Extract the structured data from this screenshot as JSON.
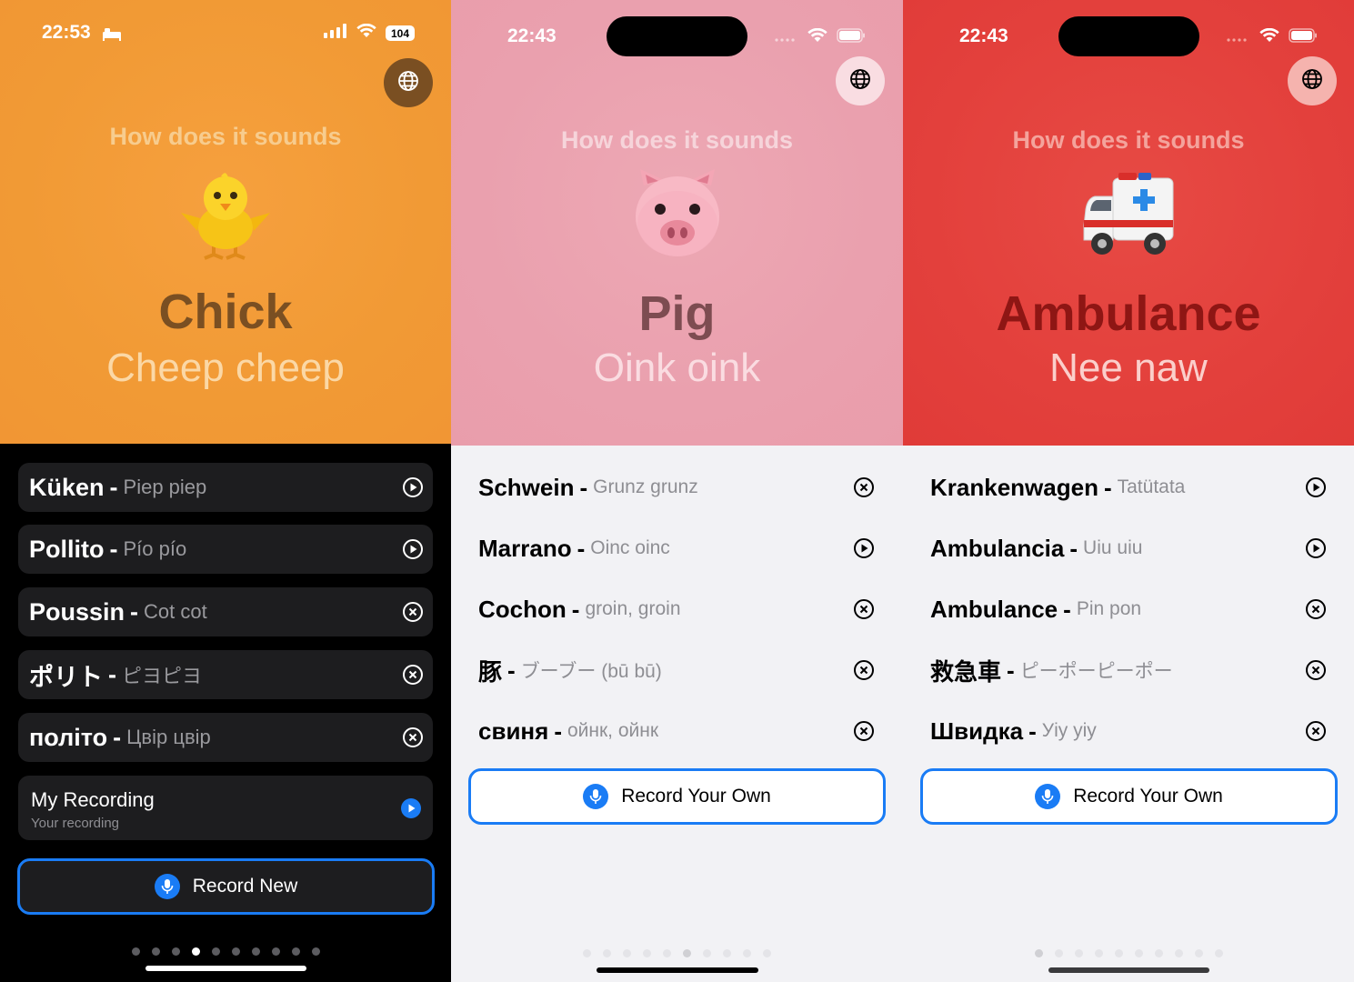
{
  "screens": [
    {
      "status": {
        "time": "22:53",
        "battery": "104"
      },
      "subtitle": "How does it sounds",
      "emoji_icon": "chick-emoji",
      "title": "Chick",
      "sound": "Cheep cheep",
      "items": [
        {
          "word": "Küken",
          "translation": "Piep piep",
          "icon": "play"
        },
        {
          "word": "Pollito",
          "translation": "Pío pío",
          "icon": "play"
        },
        {
          "word": "Poussin",
          "translation": "Cot cot",
          "icon": "close"
        },
        {
          "word": "ポリト",
          "translation": "ピヨピヨ",
          "icon": "close"
        },
        {
          "word": "політо",
          "translation": "Цвір цвір",
          "icon": "close"
        }
      ],
      "recording": {
        "title": "My Recording",
        "subtitle": "Your recording"
      },
      "record_button": "Record New",
      "page_count": 10,
      "active_page": 3
    },
    {
      "status": {
        "time": "22:43"
      },
      "subtitle": "How does it sounds",
      "emoji_icon": "pig-emoji",
      "title": "Pig",
      "sound": "Oink oink",
      "items": [
        {
          "word": "Schwein",
          "translation": "Grunz grunz",
          "icon": "close"
        },
        {
          "word": "Marrano",
          "translation": "Oinc oinc",
          "icon": "play"
        },
        {
          "word": "Cochon",
          "translation": "groin, groin",
          "icon": "close"
        },
        {
          "word": "豚",
          "translation": "ブーブー (bū bū)",
          "icon": "close"
        },
        {
          "word": "свиня",
          "translation": "ойнк, ойнк",
          "icon": "close"
        }
      ],
      "record_button": "Record Your Own",
      "page_count": 10,
      "active_page": 5
    },
    {
      "status": {
        "time": "22:43"
      },
      "subtitle": "How does it sounds",
      "emoji_icon": "ambulance-emoji",
      "title": "Ambulance",
      "sound": "Nee naw",
      "items": [
        {
          "word": "Krankenwagen",
          "translation": "Tatütata",
          "icon": "play"
        },
        {
          "word": "Ambulancia",
          "translation": "Uiu uiu",
          "icon": "play"
        },
        {
          "word": "Ambulance",
          "translation": "Pin pon",
          "icon": "close"
        },
        {
          "word": "救急車",
          "translation": "ピーポーピーポー",
          "icon": "close"
        },
        {
          "word": "Швидка",
          "translation": "Уiу уiу",
          "icon": "close"
        }
      ],
      "record_button": "Record Your Own",
      "page_count": 10,
      "active_page": 0
    }
  ],
  "colors": {
    "chick_bg": "#f19a35",
    "pig_bg": "#eaa0ae",
    "ambulance_bg": "#e3403c",
    "accent_blue": "#1a7cf5"
  }
}
